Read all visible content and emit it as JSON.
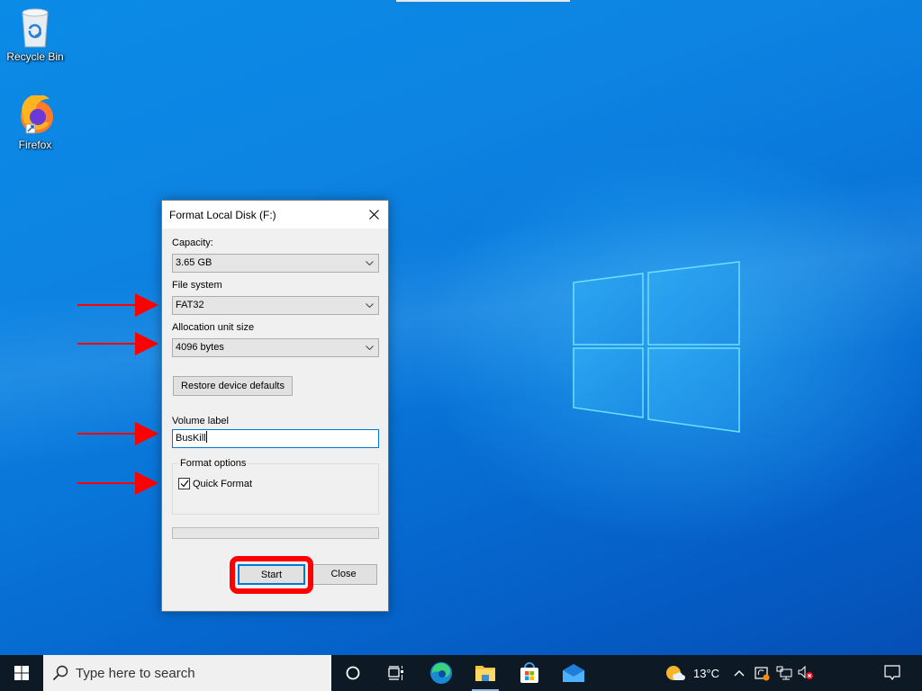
{
  "desktop": {
    "icons": [
      {
        "label": "Recycle Bin",
        "icon": "recycle-bin-icon"
      },
      {
        "label": "Firefox",
        "icon": "firefox-icon"
      }
    ]
  },
  "dialog": {
    "title": "Format Local Disk (F:)",
    "capacity_label": "Capacity:",
    "capacity_value": "3.65 GB",
    "filesystem_label": "File system",
    "filesystem_value": "FAT32",
    "allocation_label": "Allocation unit size",
    "allocation_value": "4096 bytes",
    "restore_button": "Restore device defaults",
    "volume_label_label": "Volume label",
    "volume_label_value": "BusKill",
    "format_options_label": "Format options",
    "quick_format_label": "Quick Format",
    "quick_format_checked": true,
    "progress": 0,
    "start_button": "Start",
    "close_button": "Close"
  },
  "annotations": {
    "arrow_color": "#ff0000",
    "highlight_color": "#ff0000",
    "arrows_point_to": [
      "File system",
      "Allocation unit size",
      "Volume label",
      "Quick Format"
    ],
    "highlighted": "Start"
  },
  "taskbar": {
    "search_placeholder": "Type here to search",
    "pinned": [
      "cortana-icon",
      "task-view-icon",
      "edge-icon",
      "file-explorer-icon",
      "microsoft-store-icon",
      "mail-icon"
    ],
    "weather_temp": "13°C"
  }
}
